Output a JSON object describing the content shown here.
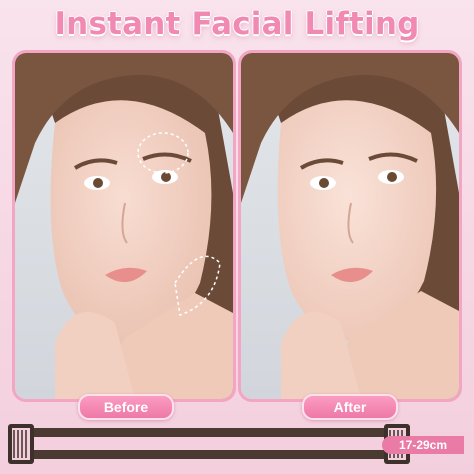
{
  "title": "Instant Facial Lifting",
  "labels": {
    "before": "Before",
    "after": "After"
  },
  "strap": {
    "size": "17-29cm"
  },
  "colors": {
    "accent": "#f08ab2",
    "pill": "#ee79a8",
    "strap": "#4a3a32",
    "background": "#f6d6e3"
  }
}
